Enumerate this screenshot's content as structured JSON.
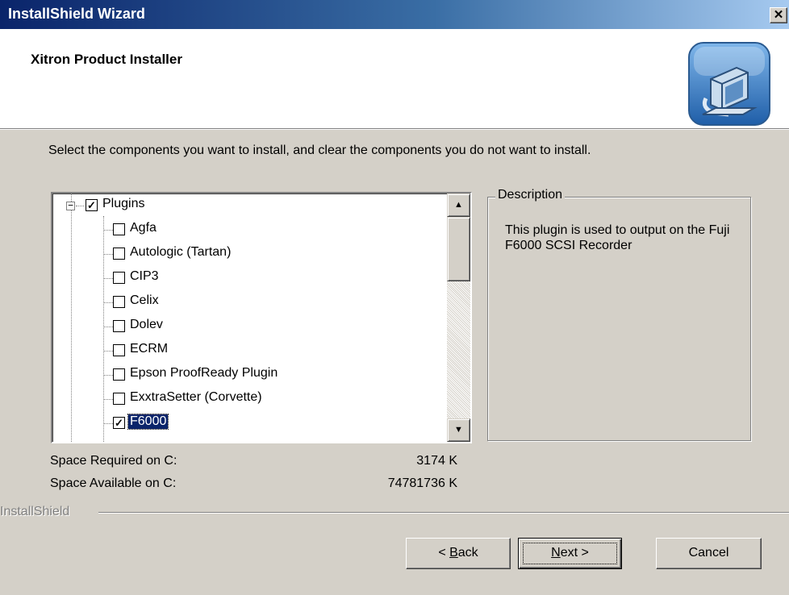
{
  "window": {
    "title": "InstallShield Wizard",
    "close_glyph": "✕"
  },
  "header": {
    "title": "Xitron Product Installer",
    "logo_icon": "installer-computer-icon"
  },
  "instruction": "Select the components you want to install, and clear the components you do not want to install.",
  "tree": {
    "root": {
      "label": "Plugins",
      "checked": true,
      "expander": "−"
    },
    "items": [
      {
        "label": "Agfa",
        "checked": false
      },
      {
        "label": "Autologic (Tartan)",
        "checked": false
      },
      {
        "label": "CIP3",
        "checked": false
      },
      {
        "label": "Celix",
        "checked": false
      },
      {
        "label": "Dolev",
        "checked": false
      },
      {
        "label": "ECRM",
        "checked": false
      },
      {
        "label": "Epson ProofReady Plugin",
        "checked": false
      },
      {
        "label": "ExxtraSetter (Corvette)",
        "checked": false
      },
      {
        "label": "F6000",
        "checked": true,
        "selected": true
      }
    ],
    "scroll_up": "▲",
    "scroll_down": "▼"
  },
  "description": {
    "legend": "Description",
    "text": "This plugin is used to output on the Fuji F6000 SCSI Recorder"
  },
  "space": {
    "required_label": "Space Required on  C:",
    "required_value": "3174 K",
    "available_label": "Space Available on  C:",
    "available_value": "74781736 K"
  },
  "branding": "InstallShield",
  "buttons": {
    "back_prefix": "< ",
    "back_mnemonic": "B",
    "back_rest": "ack",
    "next_mnemonic": "N",
    "next_rest": "ext >",
    "cancel": "Cancel"
  },
  "colors": {
    "titlebar": "#0a246a",
    "face": "#d4d0c8",
    "selection": "#0a246a"
  }
}
